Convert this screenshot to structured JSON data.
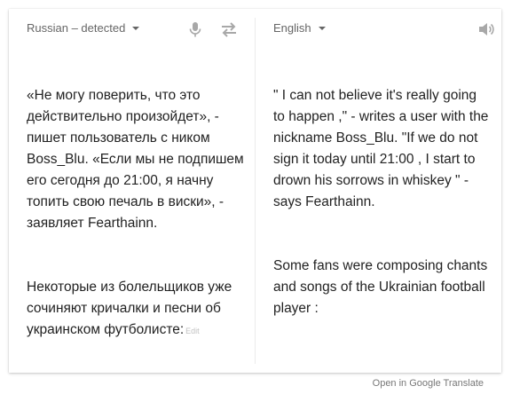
{
  "source": {
    "language_label": "Russian – detected",
    "paragraphs": [
      "«Не могу поверить, что это действительно произойдет», - пишет пользователь с ником Boss_Blu. «Если мы не подпишем его сегодня до 21:00, я начну топить свою печаль в виски», - заявляет Fearthainn.",
      "Некоторые из болельщиков уже сочиняют кричалки и песни об украинском футболисте:"
    ],
    "edit_label": "Edit",
    "mic_icon": "microphone-icon",
    "swap_icon": "swap-languages-icon"
  },
  "target": {
    "language_label": "English",
    "paragraphs": [
      "\" I can not believe it's really going to happen ,\" - writes a user with the nickname Boss_Blu. \"If we do not sign it today until 21:00 , I start to drown his sorrows in whiskey \" - says Fearthainn.",
      "Some fans were composing chants and songs of the Ukrainian football player :"
    ],
    "speaker_icon": "speaker-icon"
  },
  "footer": {
    "open_link": "Open in Google Translate"
  },
  "colors": {
    "text": "#222222",
    "muted": "#666666",
    "icon": "#a8a8a8",
    "edit": "#c2c2c2"
  }
}
